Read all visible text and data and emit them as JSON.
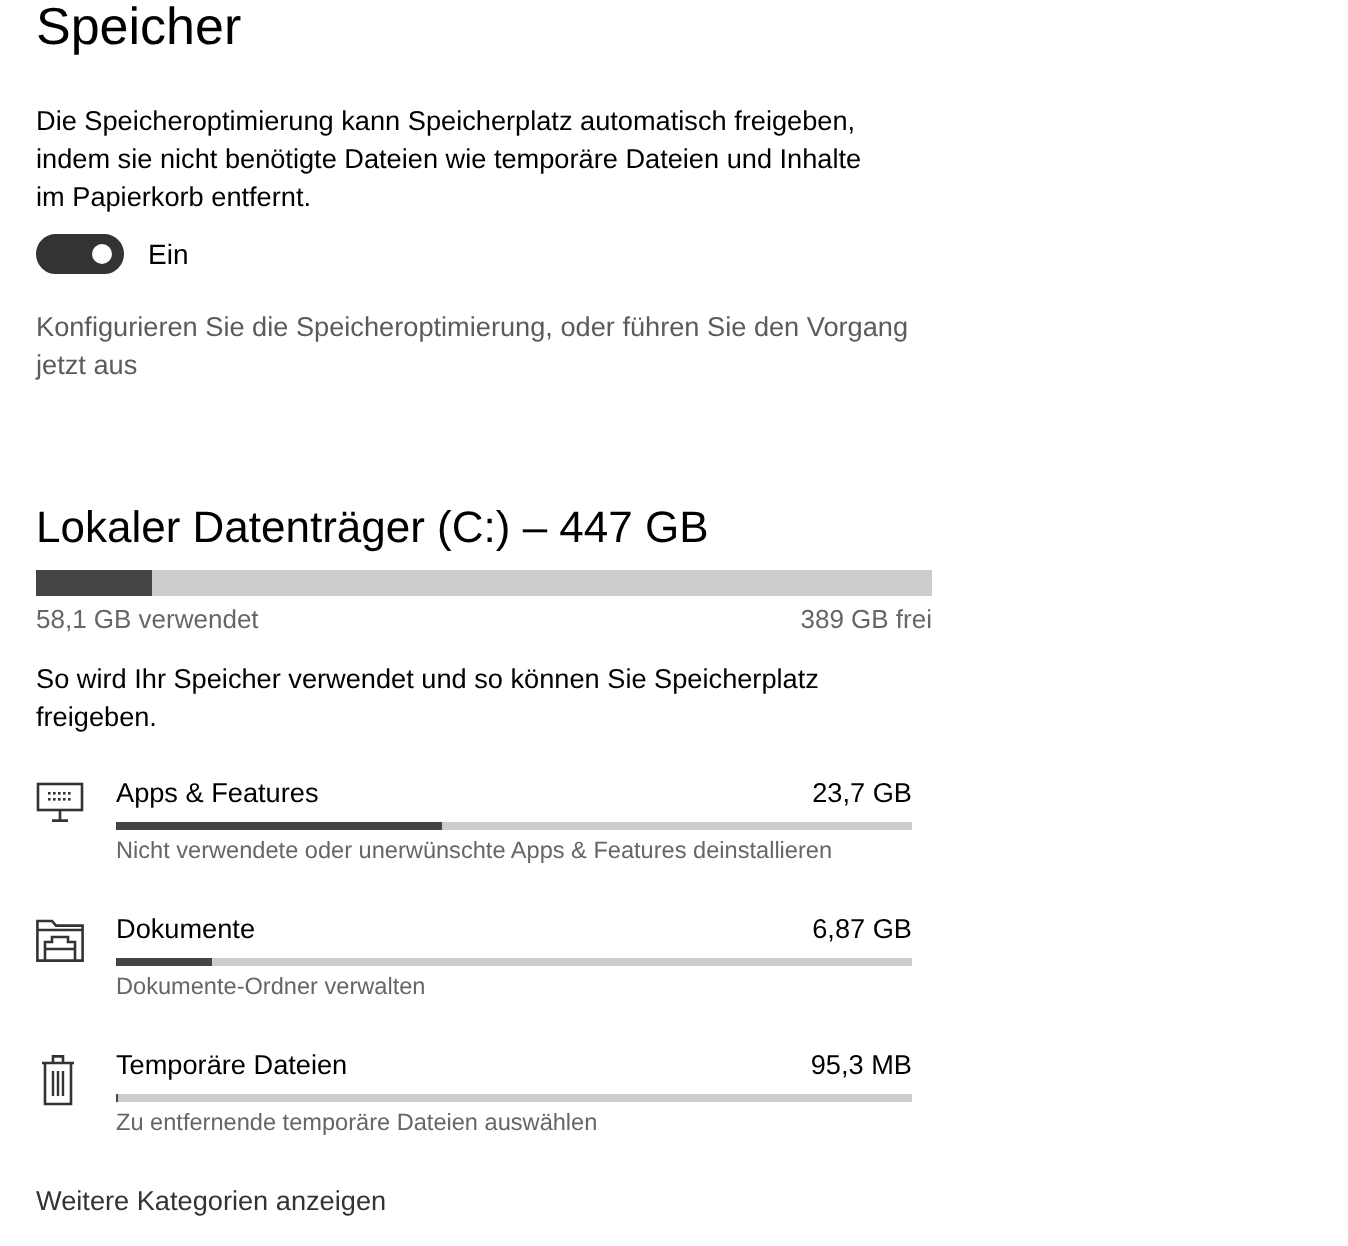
{
  "page": {
    "title": "Speicher"
  },
  "storage_sense": {
    "description": "Die Speicheroptimierung kann Speicherplatz automatisch freigeben, indem sie nicht benötigte Dateien wie temporäre Dateien und Inhalte im Papierkorb entfernt.",
    "toggle": {
      "on": true,
      "label": "Ein"
    },
    "configure_link": "Konfigurieren Sie die Speicheroptimierung, oder führen Sie den Vorgang jetzt aus"
  },
  "drive": {
    "title": "Lokaler Datenträger (C:) – 447 GB",
    "level": 0.13,
    "used": "58,1 GB verwendet",
    "free": "389 GB frei",
    "description": "So wird Ihr Speicher verwendet und so können Sie Speicherplatz freigeben."
  },
  "categories": [
    {
      "kind": "apps",
      "name": "Apps & Features",
      "size": "23,7 GB",
      "level": 0.41,
      "description": "Nicht verwendete oder unerwünschte Apps & Features deinstallieren"
    },
    {
      "kind": "documents",
      "name": "Dokumente",
      "size": "6,87 GB",
      "level": 0.12,
      "description": "Dokumente-Ordner verwalten"
    },
    {
      "kind": "temp",
      "name": "Temporäre Dateien",
      "size": "95,3 MB",
      "level": 0.003,
      "description": "Zu entfernende temporäre Dateien auswählen"
    }
  ],
  "more_link": "Weitere Kategorien anzeigen"
}
